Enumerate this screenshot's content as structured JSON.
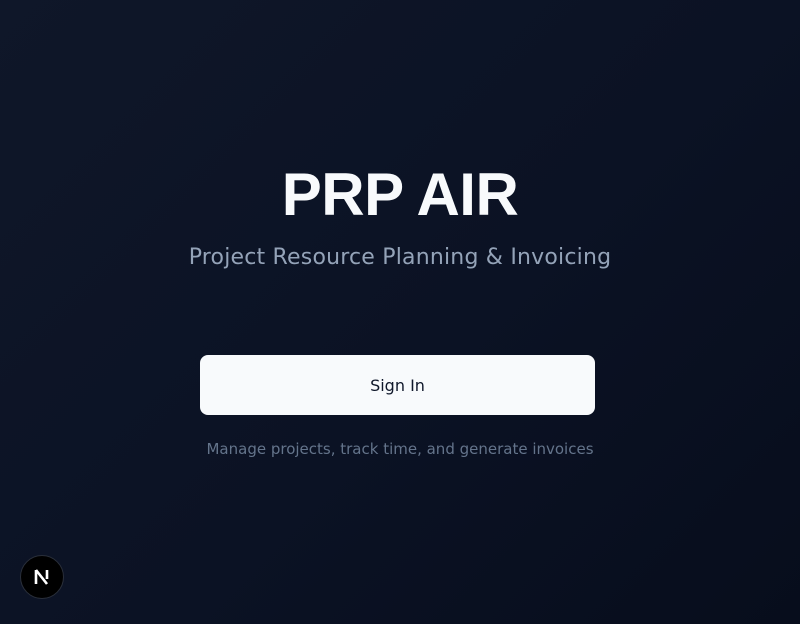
{
  "app": {
    "title": "PRP AIR",
    "subtitle": "Project Resource Planning & Invoicing"
  },
  "auth": {
    "signin_label": "Sign In",
    "tagline": "Manage projects, track time, and generate invoices"
  },
  "dev_badge": {
    "letter": "N",
    "icon": "nextjs-logo-icon"
  },
  "colors": {
    "background": "#0b1224",
    "title": "#f8fafc",
    "subtitle": "#94a3b8",
    "button_bg": "#f8fafc",
    "button_text": "#0f172a",
    "tagline": "#64748b",
    "badge_bg": "#000000"
  }
}
